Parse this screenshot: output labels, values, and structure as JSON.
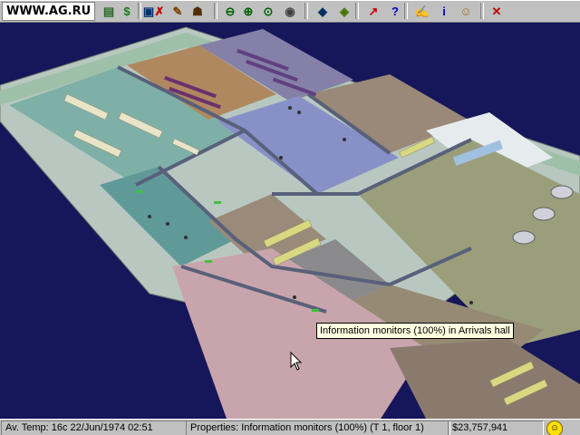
{
  "logo": {
    "text": "WWW.AG.RU"
  },
  "toolbar": {
    "buttons": [
      {
        "name": "finance-chart-button",
        "glyph": "▤",
        "color": "#2a6a2a"
      },
      {
        "name": "money-button",
        "glyph": "$",
        "color": "#1a7a1a"
      },
      {
        "name": "monitor-button",
        "glyph": "▣",
        "color": "#003070"
      },
      {
        "name": "demolish-button",
        "glyph": "✗",
        "color": "#c00000"
      },
      {
        "name": "construct-button",
        "glyph": "✎",
        "color": "#804000"
      },
      {
        "name": "bulldozer-button",
        "glyph": "☗",
        "color": "#503000"
      },
      {
        "name": "zoom-out-button",
        "glyph": "⊖",
        "color": "#006000"
      },
      {
        "name": "zoom-in-button",
        "glyph": "⊕",
        "color": "#006000"
      },
      {
        "name": "zoom-reset-button",
        "glyph": "⊙",
        "color": "#006000"
      },
      {
        "name": "camera-button",
        "glyph": "◉",
        "color": "#404040"
      },
      {
        "name": "view-rooms-button",
        "glyph": "◆",
        "color": "#003060"
      },
      {
        "name": "view-floors-button",
        "glyph": "◈",
        "color": "#407000"
      },
      {
        "name": "statistics-button",
        "glyph": "↗",
        "color": "#c00000"
      },
      {
        "name": "help-button",
        "glyph": "?",
        "color": "#0000c0"
      },
      {
        "name": "notepad-button",
        "glyph": "✍",
        "color": "#404040"
      },
      {
        "name": "info-button",
        "glyph": "i",
        "color": "#0000c0"
      },
      {
        "name": "advisor-button",
        "glyph": "☺",
        "color": "#a07020"
      },
      {
        "name": "close-button",
        "glyph": "✕",
        "color": "#c00000"
      }
    ]
  },
  "tooltip": {
    "text": "Information monitors (100%) in Arrivals hall"
  },
  "status": {
    "date_time": "Av. Temp: 16c   22/Jun/1974  02:51",
    "properties": "Properties: Information monitors (100%) (T 1, floor 1)",
    "money": "$23,757,941",
    "mood_icon": "smiley-face"
  },
  "colors": {
    "background": "#16165a",
    "toolbar": "#c0c0c0",
    "tooltip": "#ffffe1"
  }
}
